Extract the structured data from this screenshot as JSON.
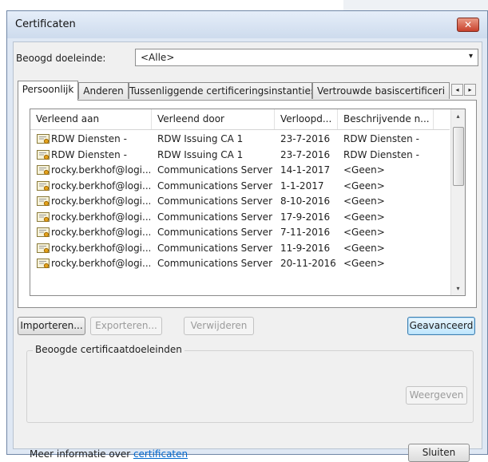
{
  "window": {
    "title": "Certificaten",
    "close_glyph": "✕"
  },
  "purpose": {
    "label": "Beoogd doeleinde:",
    "value": "<Alle>"
  },
  "tabs": [
    {
      "label": "Persoonlijk",
      "active": true
    },
    {
      "label": "Anderen",
      "active": false
    },
    {
      "label": "Tussenliggende certificeringsinstanties",
      "active": false
    },
    {
      "label": "Vertrouwde basiscertificeri",
      "active": false
    }
  ],
  "table": {
    "columns": [
      "Verleend aan",
      "Verleend door",
      "Verloopd...",
      "Beschrijvende n..."
    ],
    "rows": [
      {
        "issued_to": "RDW Diensten -",
        "issued_by": "RDW Issuing CA 1",
        "expires": "23-7-2016",
        "friendly_name": "RDW Diensten -"
      },
      {
        "issued_to": "RDW Diensten -",
        "issued_by": "RDW Issuing CA 1",
        "expires": "23-7-2016",
        "friendly_name": "RDW Diensten -"
      },
      {
        "issued_to": "rocky.berkhof@logi...",
        "issued_by": "Communications Server",
        "expires": "14-1-2017",
        "friendly_name": "<Geen>"
      },
      {
        "issued_to": "rocky.berkhof@logi...",
        "issued_by": "Communications Server",
        "expires": "1-1-2017",
        "friendly_name": "<Geen>"
      },
      {
        "issued_to": "rocky.berkhof@logi...",
        "issued_by": "Communications Server",
        "expires": "8-10-2016",
        "friendly_name": "<Geen>"
      },
      {
        "issued_to": "rocky.berkhof@logi...",
        "issued_by": "Communications Server",
        "expires": "17-9-2016",
        "friendly_name": "<Geen>"
      },
      {
        "issued_to": "rocky.berkhof@logi...",
        "issued_by": "Communications Server",
        "expires": "7-11-2016",
        "friendly_name": "<Geen>"
      },
      {
        "issued_to": "rocky.berkhof@logi...",
        "issued_by": "Communications Server",
        "expires": "11-9-2016",
        "friendly_name": "<Geen>"
      },
      {
        "issued_to": "rocky.berkhof@logi...",
        "issued_by": "Communications Server",
        "expires": "20-11-2016",
        "friendly_name": "<Geen>"
      }
    ]
  },
  "buttons": {
    "import": "Importeren...",
    "export": "Exporteren...",
    "remove": "Verwijderen",
    "advanced": "Geavanceerd",
    "view": "Weergeven",
    "close": "Sluiten"
  },
  "purposes_group": {
    "label": "Beoogde certificaatdoeleinden"
  },
  "footer": {
    "prefix": "Meer informatie over ",
    "link": "certificaten"
  },
  "icons": {
    "certificate": "certificate-icon",
    "tab_scroll_left": "◂",
    "tab_scroll_right": "▸",
    "scroll_up": "▴",
    "scroll_down": "▾",
    "dropdown": "▾"
  }
}
